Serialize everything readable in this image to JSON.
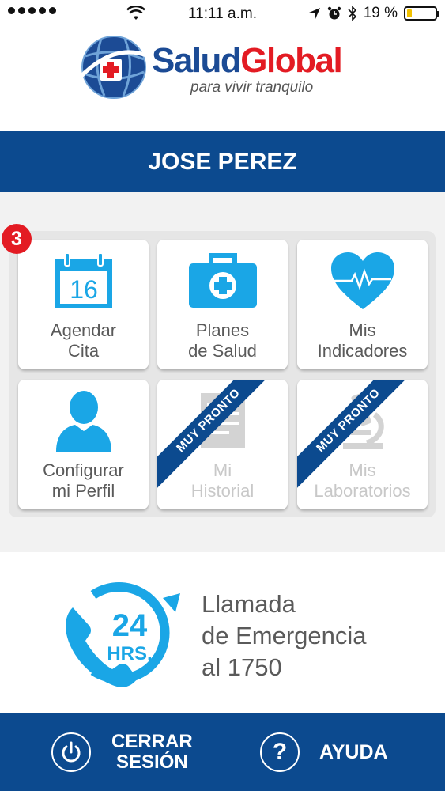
{
  "status_bar": {
    "time": "11:11 a.m.",
    "battery": "19 %",
    "battery_level": 0.19
  },
  "logo": {
    "brand_part1": "Salud",
    "brand_part2": "Global",
    "tagline": "para vivir tranquilo"
  },
  "user": {
    "name": "JOSE PEREZ"
  },
  "notification_badge": "3",
  "calendar_day": "16",
  "menu": {
    "tiles": [
      {
        "label": "Agendar\nCita",
        "line1": "Agendar",
        "line2": "Cita",
        "icon": "calendar-icon",
        "enabled": true
      },
      {
        "label": "Planes\nde Salud",
        "line1": "Planes",
        "line2": "de Salud",
        "icon": "medical-kit-icon",
        "enabled": true
      },
      {
        "label": "Mis\nIndicadores",
        "line1": "Mis",
        "line2": "Indicadores",
        "icon": "heart-pulse-icon",
        "enabled": true
      },
      {
        "label": "Configurar\nmi Perfil",
        "line1": "Configurar",
        "line2": "mi Perfil",
        "icon": "profile-icon",
        "enabled": true
      },
      {
        "label": "Mi\nHistorial",
        "line1": "Mi",
        "line2": "Historial",
        "icon": "document-icon",
        "enabled": false,
        "ribbon": "MUY PRONTO"
      },
      {
        "label": "Mis\nLaboratorios",
        "line1": "Mis",
        "line2": "Laboratorios",
        "icon": "microscope-icon",
        "enabled": false,
        "ribbon": "MUY PRONTO"
      }
    ]
  },
  "emergency": {
    "badge_number": "24",
    "badge_unit": "HRS.",
    "line1": "Llamada",
    "line2": "de Emergencia",
    "line3": "al 1750"
  },
  "bottom_bar": {
    "logout_line1": "CERRAR",
    "logout_line2": "SESIÓN",
    "help_label": "AYUDA",
    "help_glyph": "?"
  },
  "colors": {
    "primary_blue": "#0c4a8f",
    "accent_red": "#e31b23",
    "icon_cyan": "#1aa6e6",
    "disabled_text": "#c8c8c8"
  }
}
